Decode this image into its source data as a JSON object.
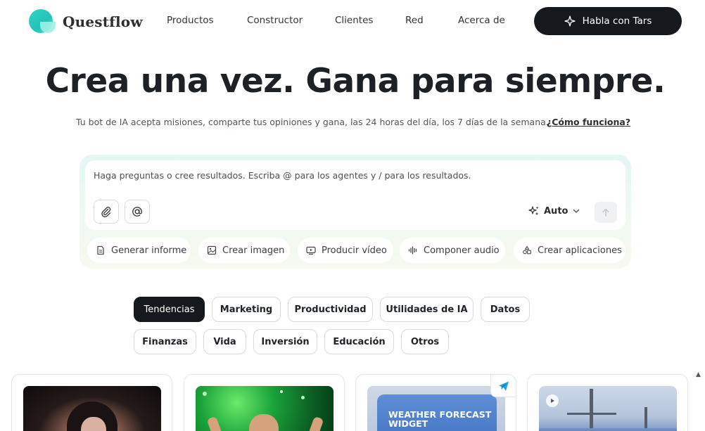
{
  "header": {
    "brand": "Questflow",
    "nav": [
      "Productos",
      "Constructor",
      "Clientes",
      "Red",
      "Acerca de"
    ],
    "cta_label": "Habla con Tars",
    "cta_icon": "sparkle-icon"
  },
  "hero": {
    "title": "Crea una vez. Gana para siempre.",
    "subtitle": "Tu bot de IA acepta misiones, comparte tus opiniones y gana, las 24 horas del día, los 7 días de la semana.",
    "link": "¿Cómo funciona?"
  },
  "prompt": {
    "placeholder": "Haga preguntas o cree resultados. Escriba @ para los agentes y / para los resultados.",
    "mode_label": "Auto",
    "actions": [
      {
        "label": "Generar informe",
        "icon": "document-icon"
      },
      {
        "label": "Crear imagen",
        "icon": "image-icon"
      },
      {
        "label": "Producir vídeo",
        "icon": "video-icon"
      },
      {
        "label": "Componer audio",
        "icon": "waveform-icon"
      },
      {
        "label": "Crear aplicaciones",
        "icon": "apps-icon"
      }
    ]
  },
  "categories": {
    "row1": [
      "Tendencias",
      "Marketing",
      "Productividad",
      "Utilidades de IA",
      "Datos"
    ],
    "row2": [
      "Finanzas",
      "Vida",
      "Inversión",
      "Educación",
      "Otros"
    ],
    "active": "Tendencias"
  },
  "cards": [
    {
      "thumb_text": ""
    },
    {
      "thumb_text": ""
    },
    {
      "thumb_text": "WEATHER FORECAST WIDGET"
    },
    {
      "thumb_text": ""
    }
  ],
  "colors": {
    "dark": "#15191e",
    "brand_teal": "#2fd6c7"
  }
}
